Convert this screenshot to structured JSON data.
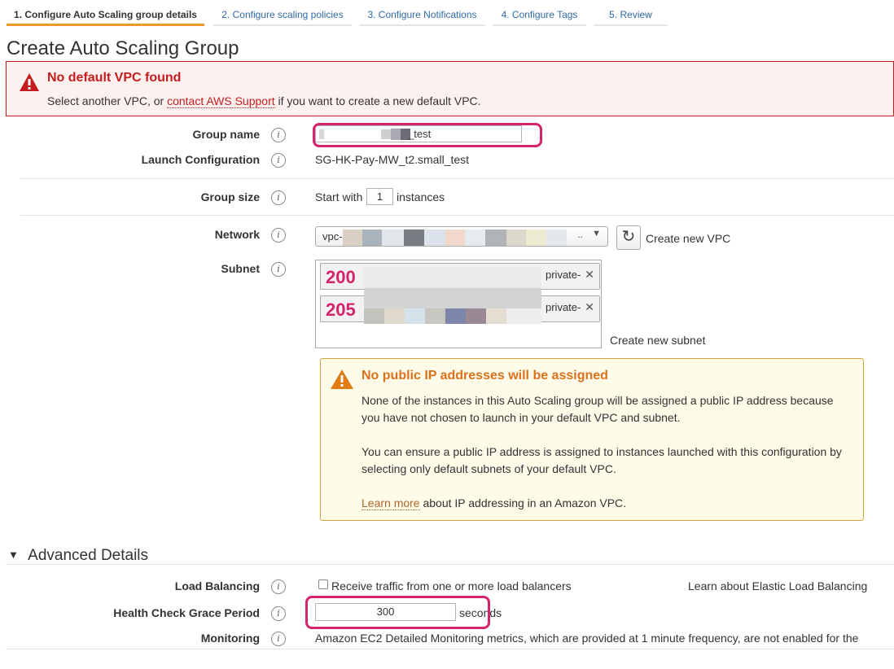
{
  "tabs": [
    {
      "label": "1. Configure Auto Scaling group details"
    },
    {
      "label": "2. Configure scaling policies"
    },
    {
      "label": "3. Configure Notifications"
    },
    {
      "label": "4. Configure Tags"
    },
    {
      "label": "5. Review"
    }
  ],
  "page_title": "Create Auto Scaling Group",
  "error": {
    "title": "No default VPC found",
    "text_before": "Select another VPC, or ",
    "link": "contact AWS Support",
    "text_after": " if you want to create a new default VPC."
  },
  "form": {
    "group_name": {
      "label": "Group name",
      "value": "_test"
    },
    "launch_configuration": {
      "label": "Launch Configuration",
      "value": "SG-HK-Pay-MW_t2.small_test"
    },
    "group_size": {
      "label": "Group size",
      "prefix": "Start with",
      "value": "1",
      "suffix": "instances"
    },
    "network": {
      "label": "Network",
      "value": "vpc-",
      "create_link": "Create new VPC"
    },
    "subnet": {
      "label": "Subnet",
      "chips": [
        {
          "num": "200",
          "suffix": "private-"
        },
        {
          "num": "205",
          "suffix": "private-"
        }
      ],
      "create_link": "Create new subnet"
    }
  },
  "warning": {
    "title": "No public IP addresses will be assigned",
    "p1": "None of the instances in this Auto Scaling group will be assigned a public IP address because you have not chosen to launch in your default VPC and subnet.",
    "p2": "You can ensure a public IP address is assigned to instances launched with this configuration by selecting only default subnets of your default VPC.",
    "learn_more": "Learn more",
    "p3_after": " about IP addressing in an Amazon VPC."
  },
  "advanced": {
    "title": "Advanced Details",
    "load_balancing": {
      "label": "Load Balancing",
      "checkbox_text": "Receive traffic from one or more load balancers",
      "learn_link": "Learn about Elastic Load Balancing"
    },
    "health_check": {
      "label": "Health Check Grace Period",
      "value": "300",
      "suffix": "seconds"
    },
    "monitoring": {
      "label": "Monitoring",
      "text": "Amazon EC2 Detailed Monitoring metrics, which are provided at 1 minute frequency, are not enabled for the"
    }
  },
  "colors": {
    "accent_tab": "#ec9a2a",
    "error": "#c41d1d",
    "warning": "#d9711e",
    "highlight": "#d6246b",
    "link": "#1a66b2"
  }
}
